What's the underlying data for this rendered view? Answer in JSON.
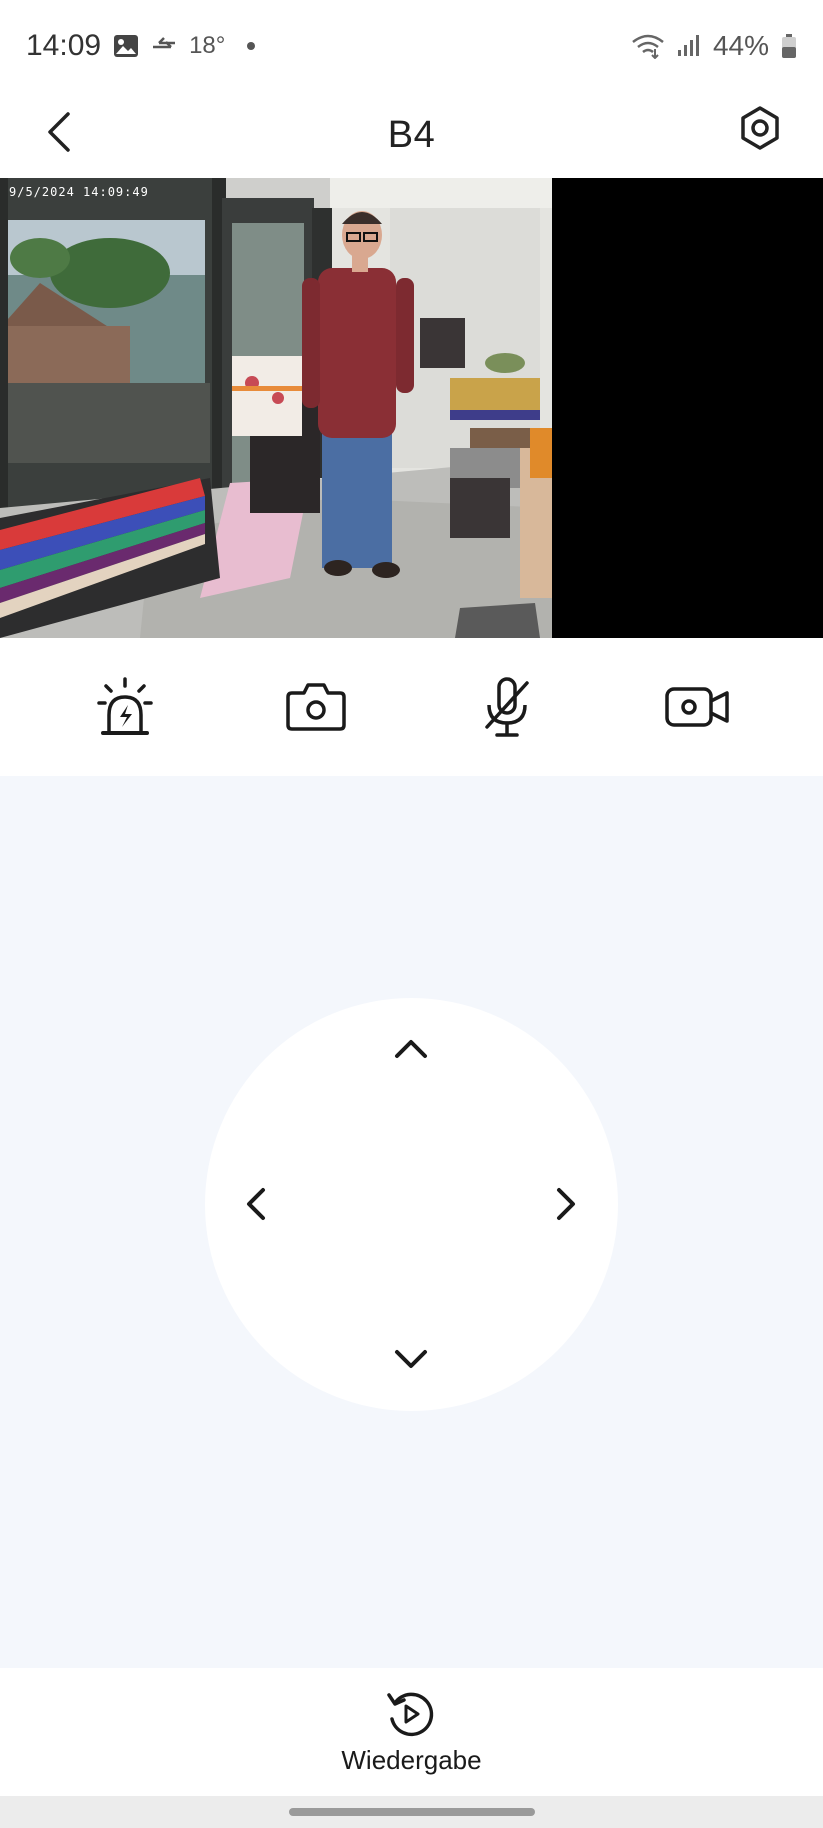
{
  "status_bar": {
    "time": "14:09",
    "temperature": "18°",
    "battery_percent": "44%"
  },
  "header": {
    "title": "B4",
    "back_icon": "chevron-left-icon",
    "settings_icon": "hexagon-settings-icon"
  },
  "camera": {
    "timestamp": "9/5/2024  14:09:49"
  },
  "controls": [
    {
      "name": "siren",
      "icon": "siren-icon"
    },
    {
      "name": "snapshot",
      "icon": "camera-icon"
    },
    {
      "name": "microphone",
      "icon": "mic-off-icon",
      "state": "muted"
    },
    {
      "name": "record",
      "icon": "video-record-icon"
    }
  ],
  "ptz": {
    "directions": [
      "up",
      "left",
      "right",
      "down"
    ]
  },
  "bottom": {
    "playback_label": "Wiedergabe",
    "playback_icon": "replay-icon"
  },
  "colors": {
    "ptz_background": "#f4f7fc",
    "icon": "#1a1a1a"
  }
}
